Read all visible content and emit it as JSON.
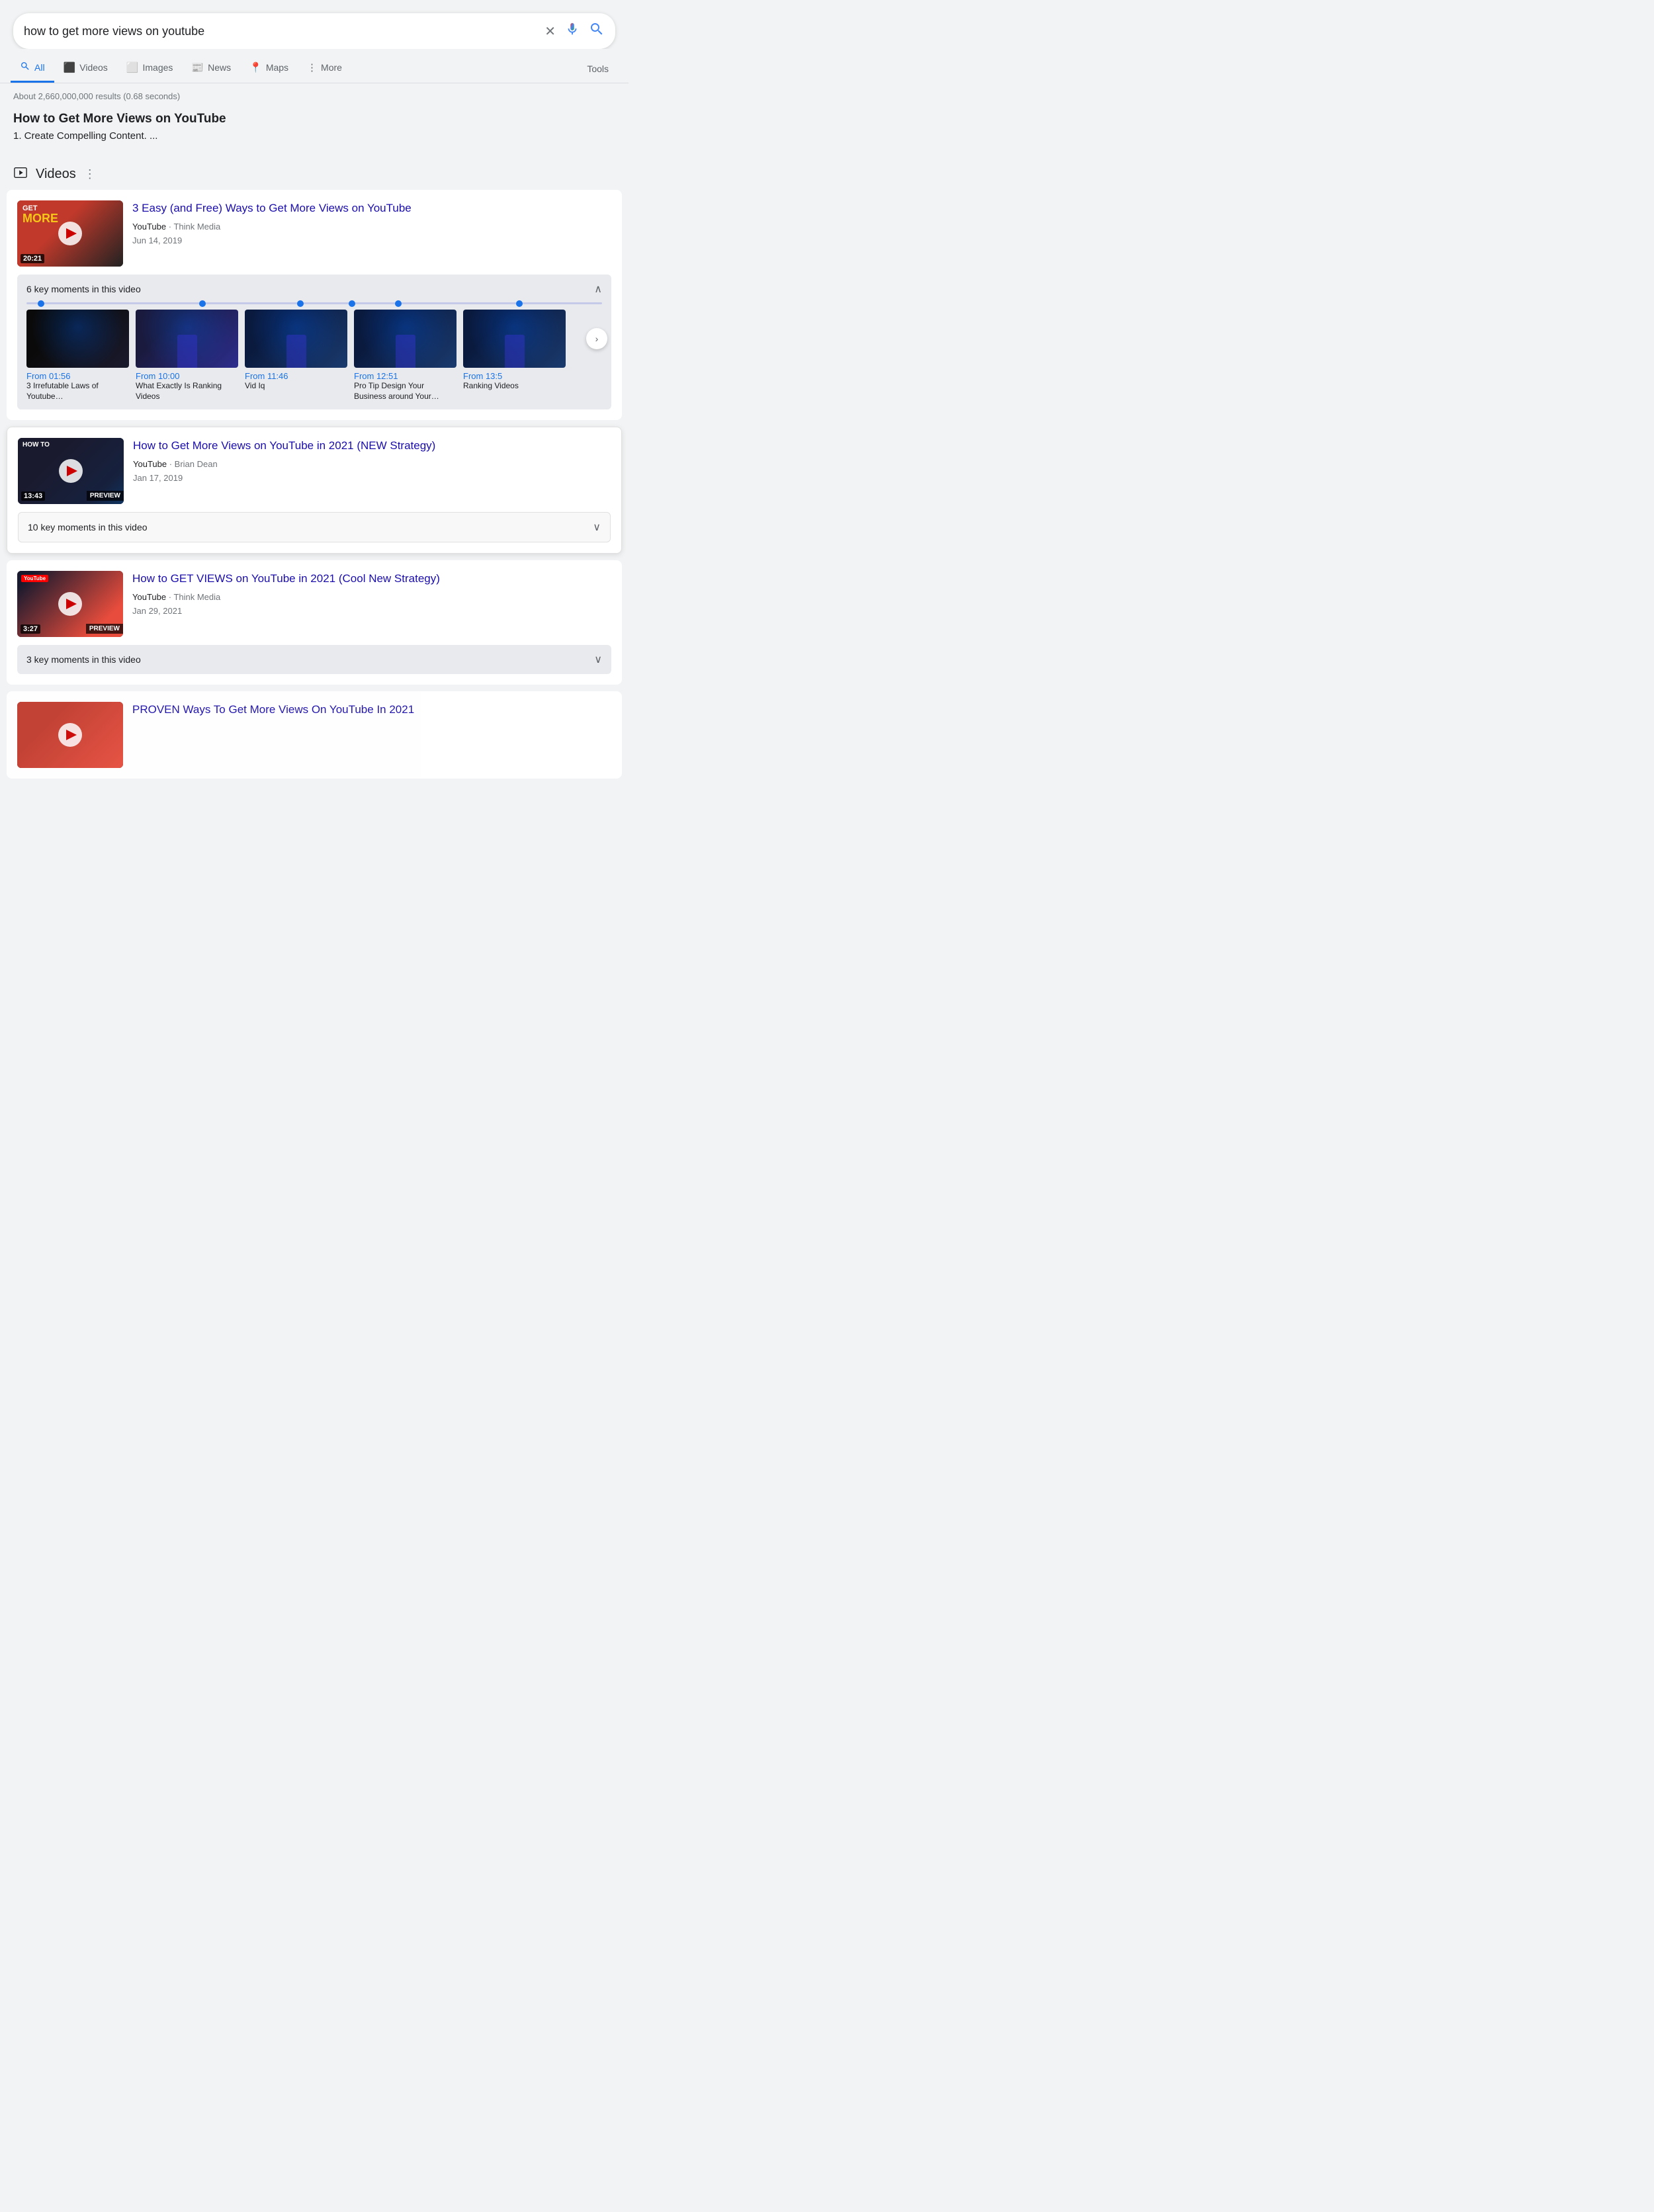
{
  "search": {
    "query": "how to get more views on youtube",
    "clear_label": "×",
    "mic_label": "🎤",
    "search_label": "🔍"
  },
  "nav": {
    "tabs": [
      {
        "id": "all",
        "label": "All",
        "icon": "🔍",
        "active": true
      },
      {
        "id": "videos",
        "label": "Videos",
        "icon": "▶",
        "active": false
      },
      {
        "id": "images",
        "label": "Images",
        "icon": "🖼",
        "active": false
      },
      {
        "id": "news",
        "label": "News",
        "icon": "📰",
        "active": false
      },
      {
        "id": "maps",
        "label": "Maps",
        "icon": "📍",
        "active": false
      },
      {
        "id": "more",
        "label": "More",
        "icon": "⋮",
        "active": false
      }
    ],
    "tools_label": "Tools"
  },
  "results_info": "About 2,660,000,000 results (0.68 seconds)",
  "featured_snippet": {
    "title": "How to Get More Views on YouTube",
    "item1": "1. Create Compelling Content. ..."
  },
  "videos_section": {
    "header_icon": "▶",
    "title": "Videos",
    "more_icon": "⋮",
    "results": [
      {
        "id": "v1",
        "title": "3 Easy (and Free) Ways to Get More Views on YouTube",
        "source": "YouTube",
        "channel": "Think Media",
        "date": "Jun 14, 2019",
        "duration": "20:21",
        "preview": false,
        "thumb_type": "get_more",
        "key_moments": {
          "label": "6 key moments in this video",
          "expanded": true,
          "dots": [
            0,
            30,
            47,
            56,
            64,
            85
          ],
          "items": [
            {
              "from": "From 01:56",
              "label": "3 Irrefutable Laws of Youtube…"
            },
            {
              "from": "From 10:00",
              "label": "What Exactly Is Ranking Videos"
            },
            {
              "from": "From 11:46",
              "label": "Vid Iq"
            },
            {
              "from": "From 12:51",
              "label": "Pro Tip Design Your Business around Your…"
            },
            {
              "from": "From 13:5",
              "label": "Ranking Videos"
            }
          ]
        }
      },
      {
        "id": "v2",
        "title": "How to Get More Views on YouTube in 2021 (NEW Strategy)",
        "source": "YouTube",
        "channel": "Brian Dean",
        "date": "Jan 17, 2019",
        "duration": "13:43",
        "preview": true,
        "thumb_type": "how_to",
        "key_moments": {
          "label": "10 key moments in this video",
          "expanded": false,
          "items": []
        }
      },
      {
        "id": "v3",
        "title": "How to GET VIEWS on YouTube in 2021 (Cool New Strategy)",
        "source": "YouTube",
        "channel": "Think Media",
        "date": "Jan 29, 2021",
        "duration": "3:27",
        "preview": true,
        "thumb_type": "yt_logo",
        "key_moments": {
          "label": "3 key moments in this video",
          "expanded": false,
          "items": []
        }
      },
      {
        "id": "v4",
        "title": "PROVEN Ways To Get More Views On YouTube In 2021",
        "partial": true,
        "thumb_type": "partial"
      }
    ]
  }
}
